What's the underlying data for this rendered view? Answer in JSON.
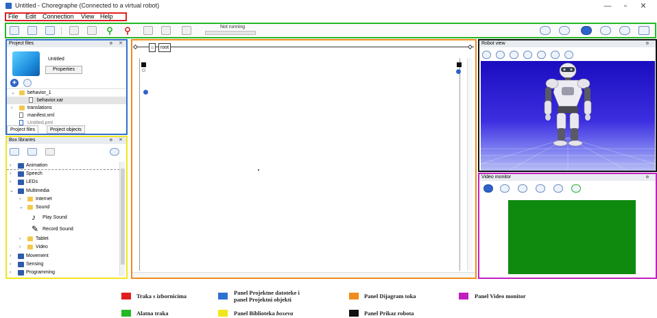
{
  "titlebar": {
    "title": "Untitled - Choregraphe (Connected to a virtual robot)",
    "min": "—",
    "max": "▫",
    "close": "✕"
  },
  "menu": [
    "File",
    "Edit",
    "Connection",
    "View",
    "Help"
  ],
  "toolbar": {
    "status": "Not running",
    "left_icons": [
      "new-project-icon",
      "open-project-icon",
      "save-project-icon",
      "undo-icon",
      "redo-icon",
      "connect-icon",
      "disconnect-icon",
      "play-icon",
      "stop-icon",
      "warning-icon"
    ],
    "right_icons": [
      "volume-icon",
      "wake-up-icon",
      "heart-icon",
      "rest-icon",
      "settings-icon",
      "battery-icon"
    ]
  },
  "project_panel": {
    "header": "Project files",
    "project_name": "Untitled",
    "properties_label": "Properties",
    "tree": [
      {
        "label": "behavior_1",
        "type": "folder",
        "expanded": true,
        "indent": 0
      },
      {
        "label": "behavior.xar",
        "type": "file",
        "indent": 1,
        "selected": true
      },
      {
        "label": "translations",
        "type": "folder",
        "expanded": false,
        "indent": 0
      },
      {
        "label": "manifest.xml",
        "type": "file",
        "indent": 0
      },
      {
        "label": "Untitled.pml",
        "type": "pml",
        "indent": 0
      }
    ],
    "tabs": [
      "Project files",
      "Project objects"
    ]
  },
  "box_panel": {
    "header": "Box libraries",
    "tree": [
      {
        "label": "Animation",
        "type": "pkg",
        "indent": 0,
        "expanded": false
      },
      {
        "label": "Speech",
        "type": "pkg",
        "indent": 0,
        "expanded": false
      },
      {
        "label": "LEDs",
        "type": "pkg",
        "indent": 0,
        "expanded": false
      },
      {
        "label": "Multimedia",
        "type": "pkg",
        "indent": 0,
        "expanded": true
      },
      {
        "label": "Internet",
        "type": "folder",
        "indent": 1,
        "expanded": false
      },
      {
        "label": "Sound",
        "type": "folder",
        "indent": 1,
        "expanded": true
      },
      {
        "label": "Play Sound",
        "type": "box-note",
        "indent": 2
      },
      {
        "label": "Record Sound",
        "type": "box-mic",
        "indent": 2
      },
      {
        "label": "Tablet",
        "type": "folder",
        "indent": 1,
        "expanded": false
      },
      {
        "label": "Video",
        "type": "folder",
        "indent": 1,
        "expanded": false
      },
      {
        "label": "Movement",
        "type": "pkg",
        "indent": 0,
        "expanded": false
      },
      {
        "label": "Sensing",
        "type": "pkg",
        "indent": 0,
        "expanded": false
      },
      {
        "label": "Programming",
        "type": "pkg",
        "indent": 0,
        "expanded": false
      }
    ]
  },
  "flow_panel": {
    "root_label": "root"
  },
  "robot_panel": {
    "header": "Robot view"
  },
  "video_panel": {
    "header": "Video monitor"
  },
  "panel_controls": {
    "float": "ɵ",
    "close": "✕"
  },
  "legend": [
    {
      "label": "Traka s izbornicima",
      "color": "#e21d1d"
    },
    {
      "label": "Alatna traka",
      "color": "#25b825"
    },
    {
      "label": "Panel Projektne datoteke i panel Projektni objekti",
      "line1": "Panel Projektne datoteke i",
      "line2": "panel Projektni objekti",
      "color": "#2f6fd0"
    },
    {
      "label": "Panel Biblioteka boxeva",
      "line_main": "Panel Biblioteka ",
      "line_em": "boxeva",
      "color": "#f1e61b"
    },
    {
      "label": "Panel Dijagram toka",
      "color": "#f08a1a"
    },
    {
      "label": "Panel Prikaz robota",
      "color": "#111111"
    },
    {
      "label": "Panel Video monitor",
      "color": "#c01ec0"
    }
  ]
}
